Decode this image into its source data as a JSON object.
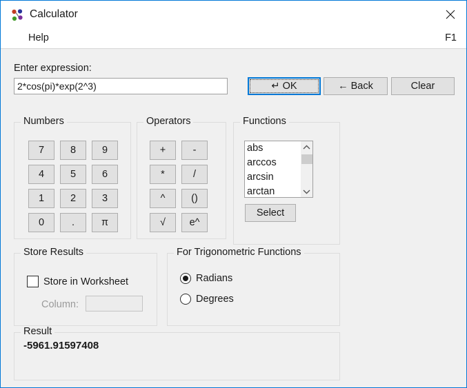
{
  "window": {
    "title": "Calculator",
    "icon": "minitab-dots-icon",
    "close_label": "✕",
    "accent_color": "#0078d7",
    "background_color": "#f0f0f0"
  },
  "menubar": {
    "help_label": "Help",
    "shortcut_label": "F1"
  },
  "expression": {
    "label": "Enter expression:",
    "value": "2*cos(pi)*exp(2^3)",
    "placeholder": ""
  },
  "toolbar": {
    "ok_label": "↵ OK",
    "back_label": "← Back",
    "clear_label": "Clear"
  },
  "numbers": {
    "title": "Numbers",
    "keys": [
      "7",
      "8",
      "9",
      "4",
      "5",
      "6",
      "1",
      "2",
      "3",
      "0",
      ".",
      "π"
    ]
  },
  "operators": {
    "title": "Operators",
    "keys": [
      "+",
      "-",
      "*",
      "/",
      "^",
      "()",
      "√",
      "e^"
    ]
  },
  "functions": {
    "title": "Functions",
    "items": [
      "abs",
      "arccos",
      "arcsin",
      "arctan"
    ],
    "select_label": "Select",
    "scroll_up_label": "⌃",
    "scroll_down_label": "⌄"
  },
  "store_results": {
    "title": "Store Results",
    "checkbox_label": "Store in Worksheet",
    "checked": false,
    "column_label": "Column:",
    "column_value": "",
    "column_placeholder": ""
  },
  "trigonometry": {
    "title": "For Trigonometric Functions",
    "options": [
      {
        "label": "Radians",
        "selected": true
      },
      {
        "label": "Degrees",
        "selected": false
      }
    ]
  },
  "result": {
    "title": "Result",
    "value": "-5961.91597408"
  }
}
